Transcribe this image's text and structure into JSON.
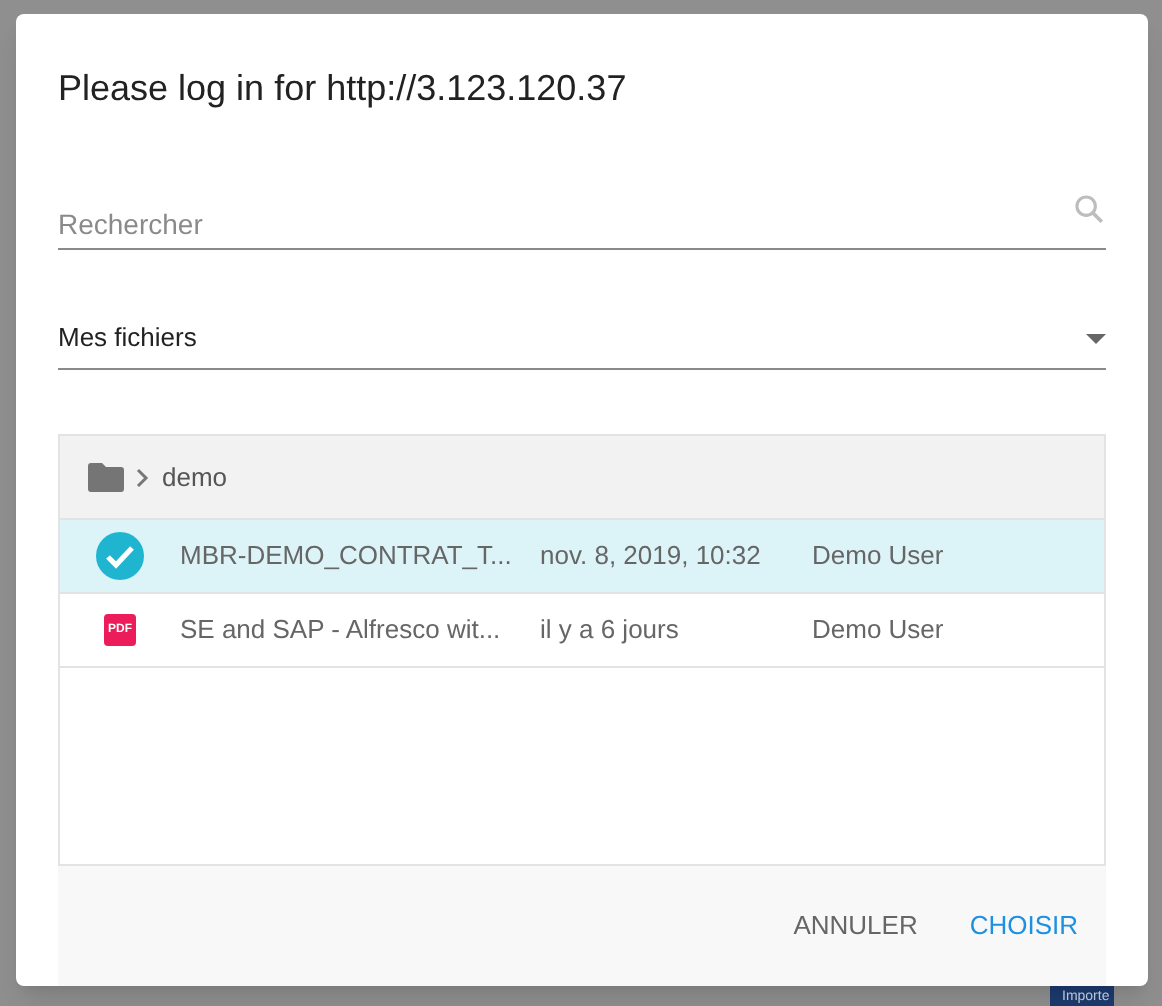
{
  "background": {
    "button": "Importe"
  },
  "dialog": {
    "title": "Please log in for http://3.123.120.37",
    "search": {
      "placeholder": "Rechercher"
    },
    "source": {
      "value": "Mes fichiers"
    },
    "breadcrumb": {
      "folder": "demo"
    },
    "rows": [
      {
        "name": "MBR-DEMO_CONTRAT_T...",
        "modified": "nov. 8, 2019, 10:32",
        "owner": "Demo User",
        "selected": true
      },
      {
        "kind": "pdf",
        "icon_text": "PDF",
        "name": "SE and SAP - Alfresco wit...",
        "modified": "il y a 6 jours",
        "owner": "Demo User",
        "selected": false
      }
    ],
    "buttons": [
      {
        "label": "ANNULER",
        "kind": "secondary"
      },
      {
        "label": "CHOISIR",
        "kind": "primary"
      }
    ]
  }
}
